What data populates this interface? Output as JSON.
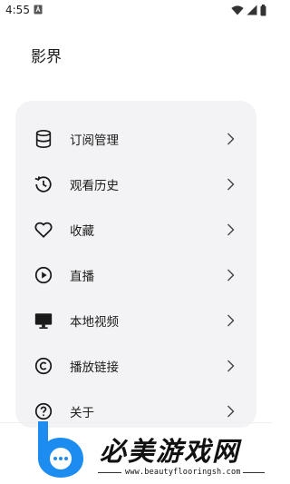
{
  "status_bar": {
    "time": "4:55",
    "notification_icon": "a-box-icon",
    "system_icons": [
      "wifi-icon",
      "signal-icon",
      "battery-icon"
    ]
  },
  "header": {
    "title": "影界"
  },
  "menu": {
    "items": [
      {
        "label": "订阅管理",
        "icon": "database-icon"
      },
      {
        "label": "观看历史",
        "icon": "history-icon"
      },
      {
        "label": "收藏",
        "icon": "heart-icon"
      },
      {
        "label": "直播",
        "icon": "play-circle-icon"
      },
      {
        "label": "本地视频",
        "icon": "monitor-icon"
      },
      {
        "label": "播放链接",
        "icon": "copyright-icon"
      },
      {
        "label": "关于",
        "icon": "help-circle-icon"
      }
    ]
  },
  "watermark": {
    "title": "必美游戏网",
    "url": "www.beautyflooringsh.com"
  }
}
